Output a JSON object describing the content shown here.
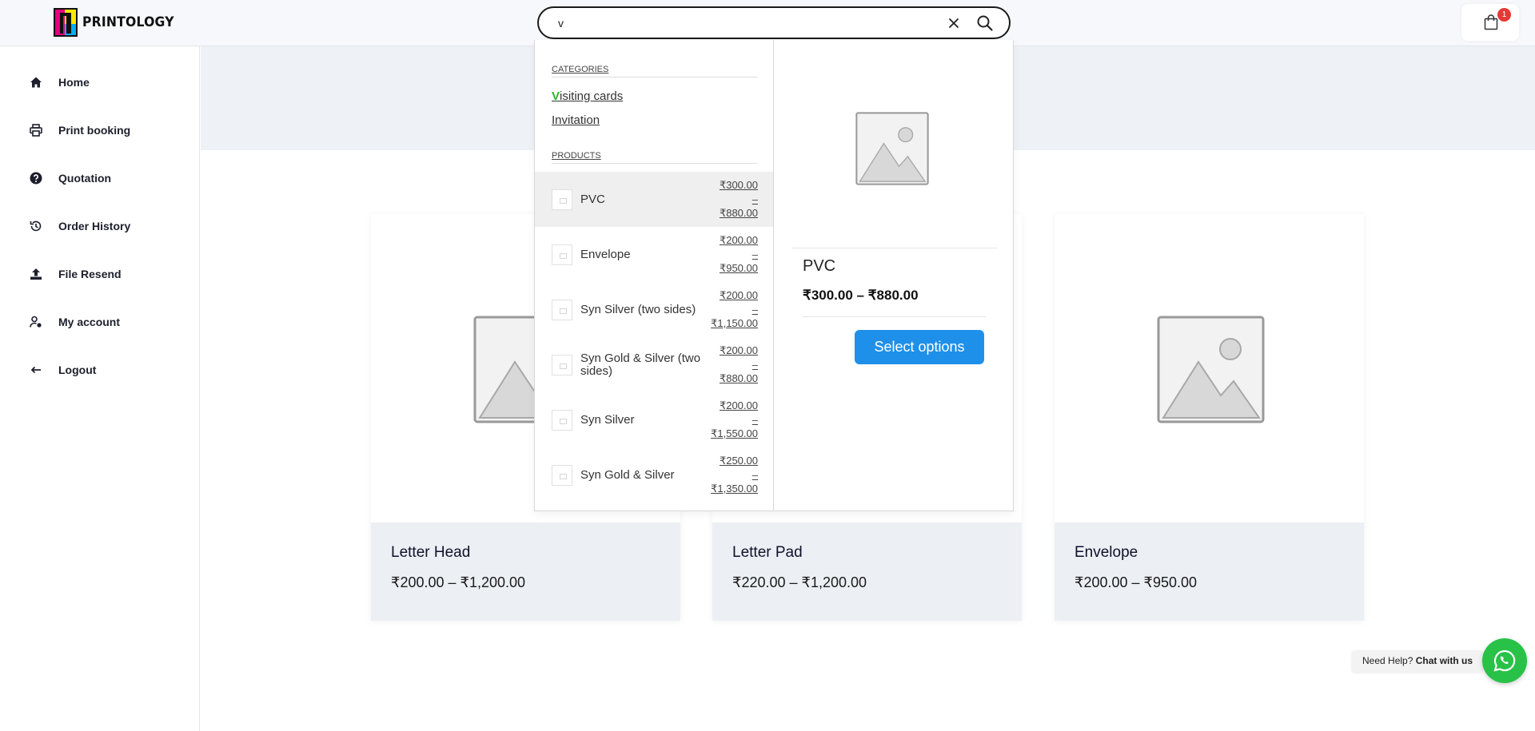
{
  "brand": {
    "name": "PRINTOLOGY",
    "logo_colors": [
      "#e6007e",
      "#00aeef",
      "#ffe600",
      "#111111"
    ]
  },
  "search": {
    "value": "v",
    "placeholder": "",
    "clear_icon": "close-icon",
    "submit_icon": "search-icon"
  },
  "cart": {
    "count": "1",
    "icon": "shopping-bag-icon"
  },
  "sidebar": {
    "items": [
      {
        "label": "Home",
        "icon": "home-icon"
      },
      {
        "label": "Print booking",
        "icon": "printer-icon"
      },
      {
        "label": "Quotation",
        "icon": "question-circle-icon"
      },
      {
        "label": "Order History",
        "icon": "history-icon"
      },
      {
        "label": "File Resend",
        "icon": "upload-icon"
      },
      {
        "label": "My account",
        "icon": "user-gear-icon"
      },
      {
        "label": "Logout",
        "icon": "arrow-left-icon"
      }
    ]
  },
  "products": [
    {
      "title": "Letter Head",
      "price": "₹200.00 – ₹1,200.00"
    },
    {
      "title": "Letter Pad",
      "price": "₹220.00 – ₹1,200.00"
    },
    {
      "title": "Envelope",
      "price": "₹200.00 – ₹950.00"
    }
  ],
  "dropdown": {
    "categories_heading": "CATEGORIES",
    "categories": [
      {
        "highlight": "V",
        "rest": "isiting cards"
      },
      {
        "highlight": "",
        "rest": "Invitation"
      }
    ],
    "products_heading": "PRODUCTS",
    "results": [
      {
        "name": "PVC",
        "price_from": "₹300.00",
        "dash": "–",
        "price_to": "₹880.00"
      },
      {
        "name": "Envelope",
        "price_from": "₹200.00",
        "dash": "–",
        "price_to": "₹950.00"
      },
      {
        "name": "Syn Silver (two sides)",
        "price_from": "₹200.00",
        "dash": "–",
        "price_to": "₹1,150.00"
      },
      {
        "name": "Syn Gold & Silver (two sides)",
        "price_from": "₹200.00",
        "dash": "–",
        "price_to": "₹880.00"
      },
      {
        "name": "Syn Silver",
        "price_from": "₹200.00",
        "dash": "–",
        "price_to": "₹1,550.00"
      },
      {
        "name": "Syn Gold & Silver",
        "price_from": "₹250.00",
        "dash": "–",
        "price_to": "₹1,350.00"
      }
    ],
    "preview": {
      "title": "PVC",
      "price": "₹300.00 – ₹880.00",
      "button": "Select options"
    }
  },
  "chat": {
    "prefix": "Need Help?",
    "strong": "Chat with us",
    "icon": "whatsapp-icon",
    "color": "#27c247"
  },
  "colors": {
    "accent": "#1e90ea",
    "banner": "#eef1f6",
    "highlight": "#2ab72a"
  }
}
